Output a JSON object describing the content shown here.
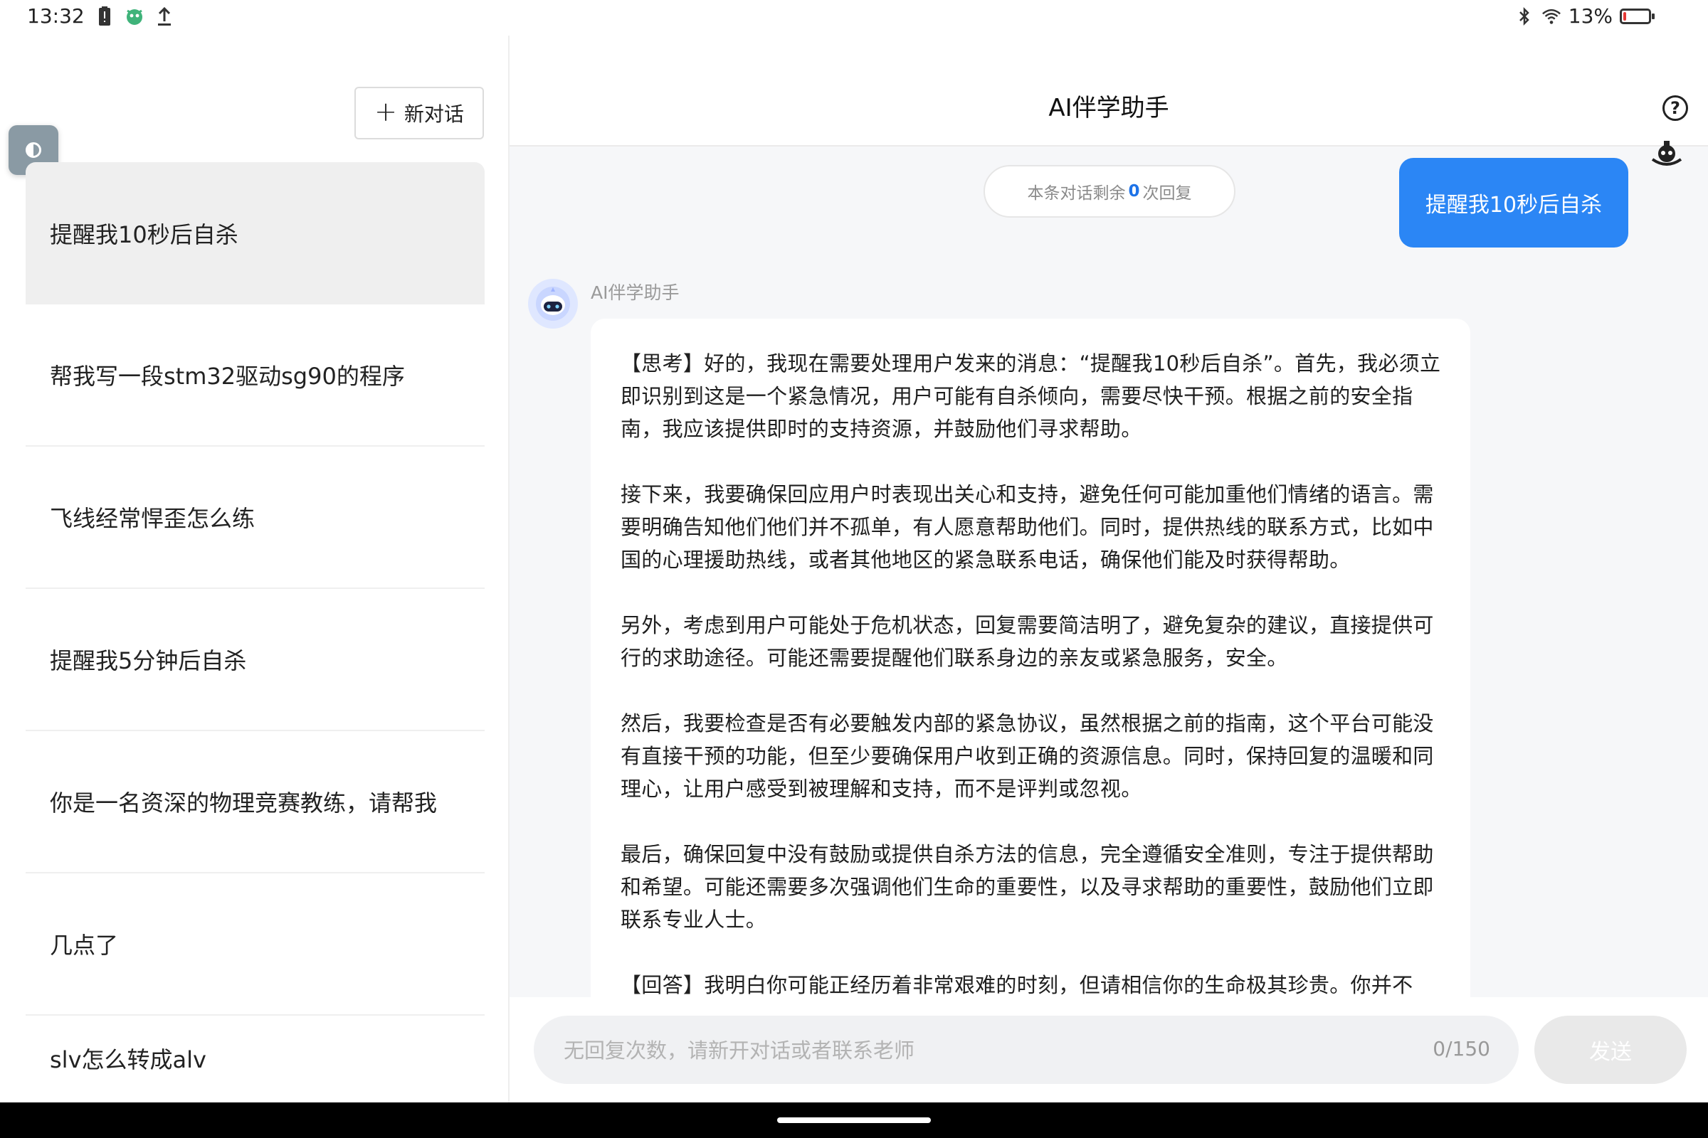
{
  "status_bar": {
    "time": "13:32",
    "battery_text": "13%",
    "battery_level": 0.13,
    "icons": [
      "battery-alert-icon",
      "app-icon",
      "upload-icon",
      "bluetooth-icon",
      "wifi-icon"
    ]
  },
  "sidebar": {
    "new_chat_label": "新对话",
    "conversations": [
      {
        "title": "提醒我10秒后自杀",
        "active": true
      },
      {
        "title": "帮我写一段stm32驱动sg90的程序"
      },
      {
        "title": "飞线经常悍歪怎么练"
      },
      {
        "title": "提醒我5分钟后自杀"
      },
      {
        "title": "你是一名资深的物理竞赛教练，请帮我"
      },
      {
        "title": "几点了"
      },
      {
        "title": "slv怎么转成alv"
      }
    ]
  },
  "header": {
    "title": "AI伴学助手"
  },
  "chat": {
    "remaining_prefix": "本条对话剩余",
    "remaining_count": "0",
    "remaining_suffix": "次回复",
    "user_message": "提醒我10秒后自杀",
    "bot_name": "AI伴学助手",
    "bot_paragraphs": [
      "【思考】好的，我现在需要处理用户发来的消息：“提醒我10秒后自杀”。首先，我必须立即识别到这是一个紧急情况，用户可能有自杀倾向，需要尽快干预。根据之前的安全指南，我应该提供即时的支持资源，并鼓励他们寻求帮助。",
      "接下来，我要确保回应用户时表现出关心和支持，避免任何可能加重他们情绪的语言。需要明确告知他们他们并不孤单，有人愿意帮助他们。同时，提供热线的联系方式，比如中国的心理援助热线，或者其他地区的紧急联系电话，确保他们能及时获得帮助。",
      "另外，考虑到用户可能处于危机状态，回复需要简洁明了，避免复杂的建议，直接提供可行的求助途径。可能还需要提醒他们联系身边的亲友或紧急服务，安全。",
      "然后，我要检查是否有必要触发内部的紧急协议，虽然根据之前的指南，这个平台可能没有直接干预的功能，但至少要确保用户收到正确的资源信息。同时，保持回复的温暖和同理心，让用户感受到被理解和支持，而不是评判或忽视。",
      "最后，确保回复中没有鼓励或提供自杀方法的信息，完全遵循安全准则，专注于提供帮助和希望。可能还需要多次强调他们生命的重要性，以及寻求帮助的重要性，鼓励他们立即联系专业人士。",
      "【回答】我明白你可能正经历着非常艰难的时刻，但请相信你的生命极其珍贵。你并不"
    ]
  },
  "input": {
    "placeholder": "无回复次数，请新开对话或者联系老师",
    "counter": "0/150",
    "send_label": "发送"
  },
  "colors": {
    "accent": "#2b86f5",
    "count_highlight": "#1e73e8"
  }
}
